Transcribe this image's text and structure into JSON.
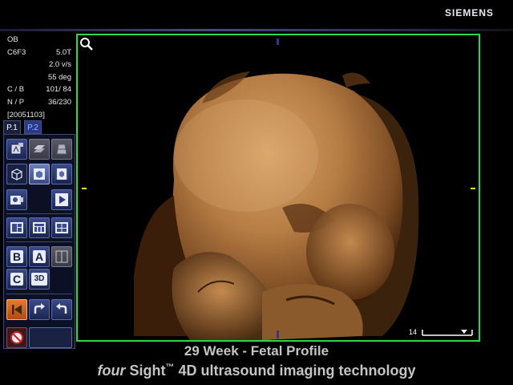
{
  "brand": "SIEMENS",
  "params": [
    {
      "label": "OB",
      "value": ""
    },
    {
      "label": "C6F3",
      "value": "5.0T"
    },
    {
      "label": "",
      "value": "2.0  v/s"
    },
    {
      "label": "",
      "value": "55 deg"
    },
    {
      "label": "C / B",
      "value": "101/  84"
    },
    {
      "label": "N / P",
      "value": "36/230"
    },
    {
      "label": "[20051103]",
      "value": ""
    }
  ],
  "tabs": {
    "p1": "P.1",
    "p2": "P.2"
  },
  "tool_icons": {
    "letter_b": "B",
    "letter_a": "A",
    "letter_c": "C",
    "label_3d": "3D"
  },
  "image": {
    "depth_value": "14"
  },
  "caption": {
    "line1": "29 Week - Fetal Profile",
    "line2_italic": "four",
    "line2_brand": "Sight",
    "line2_tm": "™",
    "line2_rest": " 4D ultrasound imaging technology"
  },
  "colors": {
    "viewport_border": "#2ed64a",
    "skin": "#b07a44",
    "tab_active_bg": "#1a1f3a",
    "panel_button": "#3a4a8a"
  }
}
